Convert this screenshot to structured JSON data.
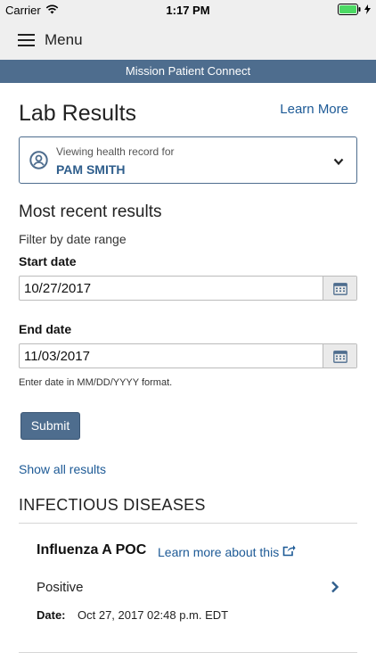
{
  "status_bar": {
    "carrier": "Carrier",
    "time": "1:17 PM"
  },
  "header": {
    "menu_label": "Menu",
    "brand": "Mission Patient Connect"
  },
  "page": {
    "title": "Lab Results",
    "learn_more": "Learn More"
  },
  "record_selector": {
    "caption": "Viewing health record for",
    "patient_name": "PAM SMITH"
  },
  "filter": {
    "heading": "Most recent results",
    "label": "Filter by date range",
    "start_label": "Start date",
    "start_value": "10/27/2017",
    "end_label": "End date",
    "end_value": "11/03/2017",
    "hint": "Enter date in MM/DD/YYYY format.",
    "submit_label": "Submit",
    "show_all": "Show all results"
  },
  "results": {
    "category": "INFECTIOUS DISEASES",
    "items": [
      {
        "name": "Influenza A POC",
        "learn_link": "Learn more about this",
        "value": "Positive",
        "date_label": "Date:",
        "date_value": "Oct 27, 2017 02:48 p.m. EDT"
      }
    ]
  },
  "colors": {
    "brand": "#4e6d8e",
    "link": "#1d5a96",
    "battery": "#4cd964"
  },
  "icons": [
    "wifi-icon",
    "battery-icon",
    "menu-icon",
    "user-circle-icon",
    "chevron-down-icon",
    "calendar-icon",
    "external-link-icon",
    "chevron-right-icon"
  ]
}
